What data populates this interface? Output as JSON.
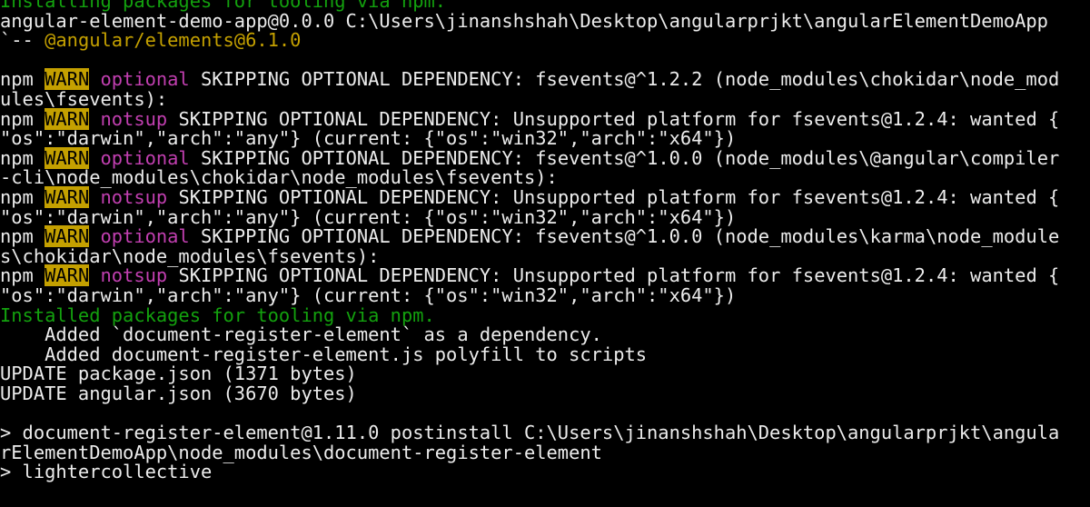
{
  "window": {
    "type": "terminal",
    "background": "#000000"
  },
  "colors": {
    "default": "#ececec",
    "green": "#13a10e",
    "olive": "#c4a000",
    "warn_bg": "#c4a000",
    "warn_fg": "#000000",
    "magenta": "#c13fb0"
  },
  "lines": [
    [
      {
        "t": "Installing packages for tooling via npm.",
        "c": "green"
      }
    ],
    [
      {
        "t": "angular-element-demo-app@0.0.0 C:\\Users\\jinanshshah\\Desktop\\angularprjkt\\angularElementDemoApp",
        "c": "default"
      }
    ],
    [
      {
        "t": "`-- ",
        "c": "default"
      },
      {
        "t": "@angular/elements@6.1.0",
        "c": "olive"
      }
    ],
    [],
    [
      {
        "t": "npm ",
        "c": "default"
      },
      {
        "t": "WARN",
        "c": "warn"
      },
      {
        "t": " ",
        "c": "default"
      },
      {
        "t": "optional",
        "c": "magenta"
      },
      {
        "t": " SKIPPING OPTIONAL DEPENDENCY: fsevents@^1.2.2 (node_modules\\chokidar\\node_mod",
        "c": "default"
      }
    ],
    [
      {
        "t": "ules\\fsevents):",
        "c": "default"
      }
    ],
    [
      {
        "t": "npm ",
        "c": "default"
      },
      {
        "t": "WARN",
        "c": "warn"
      },
      {
        "t": " ",
        "c": "default"
      },
      {
        "t": "notsup",
        "c": "magenta"
      },
      {
        "t": " SKIPPING OPTIONAL DEPENDENCY: Unsupported platform for fsevents@1.2.4: wanted {",
        "c": "default"
      }
    ],
    [
      {
        "t": "\"os\":\"darwin\",\"arch\":\"any\"} (current: {\"os\":\"win32\",\"arch\":\"x64\"})",
        "c": "default"
      }
    ],
    [
      {
        "t": "npm ",
        "c": "default"
      },
      {
        "t": "WARN",
        "c": "warn"
      },
      {
        "t": " ",
        "c": "default"
      },
      {
        "t": "optional",
        "c": "magenta"
      },
      {
        "t": " SKIPPING OPTIONAL DEPENDENCY: fsevents@^1.0.0 (node_modules\\@angular\\compiler",
        "c": "default"
      }
    ],
    [
      {
        "t": "-cli\\node_modules\\chokidar\\node_modules\\fsevents):",
        "c": "default"
      }
    ],
    [
      {
        "t": "npm ",
        "c": "default"
      },
      {
        "t": "WARN",
        "c": "warn"
      },
      {
        "t": " ",
        "c": "default"
      },
      {
        "t": "notsup",
        "c": "magenta"
      },
      {
        "t": " SKIPPING OPTIONAL DEPENDENCY: Unsupported platform for fsevents@1.2.4: wanted {",
        "c": "default"
      }
    ],
    [
      {
        "t": "\"os\":\"darwin\",\"arch\":\"any\"} (current: {\"os\":\"win32\",\"arch\":\"x64\"})",
        "c": "default"
      }
    ],
    [
      {
        "t": "npm ",
        "c": "default"
      },
      {
        "t": "WARN",
        "c": "warn"
      },
      {
        "t": " ",
        "c": "default"
      },
      {
        "t": "optional",
        "c": "magenta"
      },
      {
        "t": " SKIPPING OPTIONAL DEPENDENCY: fsevents@^1.0.0 (node_modules\\karma\\node_module",
        "c": "default"
      }
    ],
    [
      {
        "t": "s\\chokidar\\node_modules\\fsevents):",
        "c": "default"
      }
    ],
    [
      {
        "t": "npm ",
        "c": "default"
      },
      {
        "t": "WARN",
        "c": "warn"
      },
      {
        "t": " ",
        "c": "default"
      },
      {
        "t": "notsup",
        "c": "magenta"
      },
      {
        "t": " SKIPPING OPTIONAL DEPENDENCY: Unsupported platform for fsevents@1.2.4: wanted {",
        "c": "default"
      }
    ],
    [
      {
        "t": "\"os\":\"darwin\",\"arch\":\"any\"} (current: {\"os\":\"win32\",\"arch\":\"x64\"})",
        "c": "default"
      }
    ],
    [
      {
        "t": "Installed packages for tooling via npm.",
        "c": "green"
      }
    ],
    [
      {
        "t": "    Added `document-register-element` as a dependency.",
        "c": "default"
      }
    ],
    [
      {
        "t": "    Added document-register-element.js polyfill to scripts",
        "c": "default"
      }
    ],
    [
      {
        "t": "UPDATE package.json (1371 bytes)",
        "c": "default"
      }
    ],
    [
      {
        "t": "UPDATE angular.json (3670 bytes)",
        "c": "default"
      }
    ],
    [],
    [
      {
        "t": "> document-register-element@1.11.0 postinstall C:\\Users\\jinanshshah\\Desktop\\angularprjkt\\angula",
        "c": "default"
      }
    ],
    [
      {
        "t": "rElementDemoApp\\node_modules\\document-register-element",
        "c": "default"
      }
    ],
    [
      {
        "t": "> lightercollective",
        "c": "default"
      }
    ]
  ]
}
